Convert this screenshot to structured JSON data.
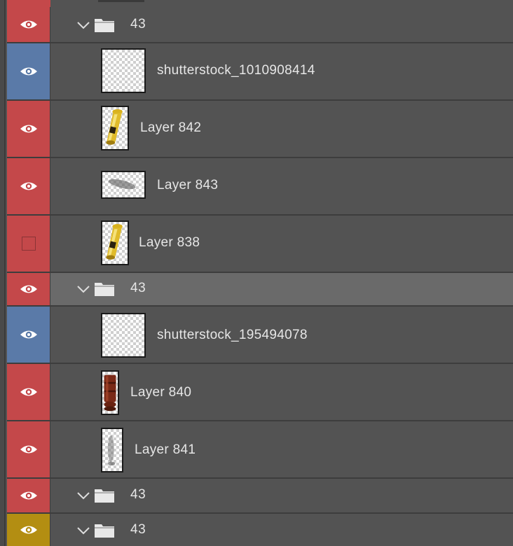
{
  "colors": {
    "visible_red": "#c4484a",
    "visible_blue": "#5a7aa8",
    "visible_yellow": "#b38e12",
    "panel_bg": "#535353",
    "selected_bg": "#6a6a6a"
  },
  "layers": [
    {
      "kind": "group",
      "name": "43",
      "visibility_color": "red",
      "expanded": true,
      "eye_icon": "eye-icon"
    },
    {
      "kind": "layer",
      "name": "shutterstock_1010908414",
      "visibility_color": "blue",
      "thumbnail": "transparent",
      "eye_icon": "eye-icon"
    },
    {
      "kind": "layer",
      "name": "Layer 842",
      "visibility_color": "red",
      "thumbnail": "gold-whistle",
      "eye_icon": "eye-icon"
    },
    {
      "kind": "layer",
      "name": "Layer 843",
      "visibility_color": "red",
      "thumbnail": "shadow",
      "eye_icon": "eye-icon"
    },
    {
      "kind": "layer",
      "name": "Layer 838",
      "visibility_color": "red",
      "thumbnail": "gold-whistle",
      "eye_icon": "hidden-box"
    },
    {
      "kind": "group",
      "name": "43",
      "visibility_color": "red",
      "expanded": true,
      "selected": true,
      "eye_icon": "eye-icon"
    },
    {
      "kind": "layer",
      "name": "shutterstock_195494078",
      "visibility_color": "blue",
      "thumbnail": "transparent",
      "eye_icon": "eye-icon"
    },
    {
      "kind": "layer",
      "name": "Layer 840",
      "visibility_color": "red",
      "thumbnail": "wood-whistle",
      "eye_icon": "eye-icon"
    },
    {
      "kind": "layer",
      "name": "Layer 841",
      "visibility_color": "red",
      "thumbnail": "shadow-vertical",
      "eye_icon": "eye-icon"
    },
    {
      "kind": "group",
      "name": "43",
      "visibility_color": "red",
      "expanded": true,
      "eye_icon": "eye-icon"
    },
    {
      "kind": "group",
      "name": "43",
      "visibility_color": "yellow",
      "expanded": true,
      "eye_icon": "eye-icon"
    }
  ]
}
